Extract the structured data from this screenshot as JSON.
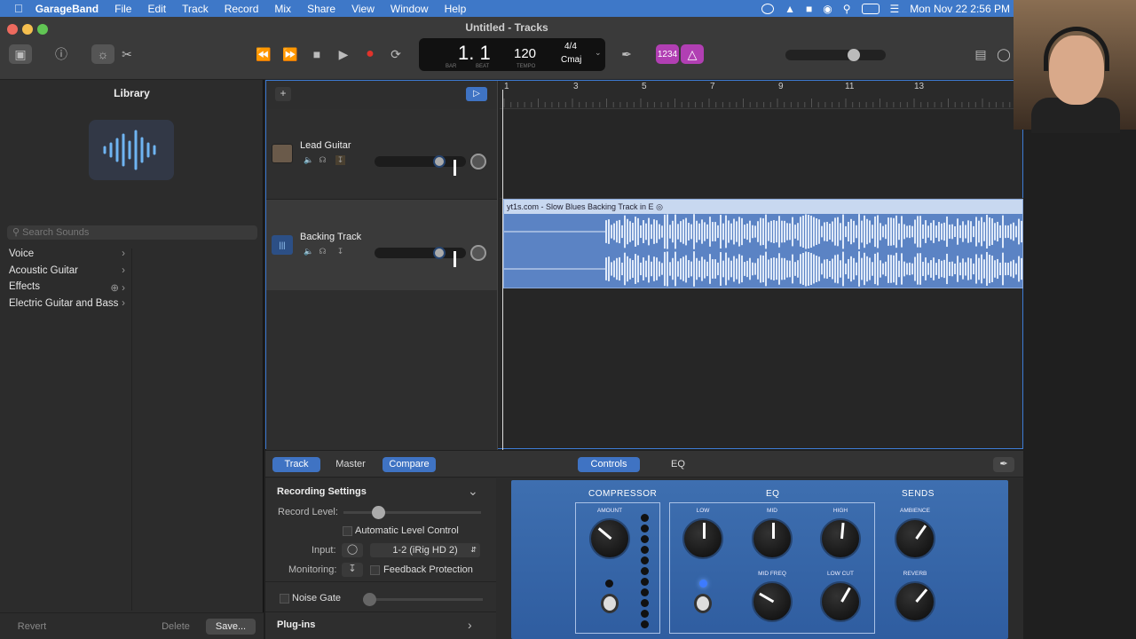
{
  "menubar": {
    "app": "GarageBand",
    "items": [
      "File",
      "Edit",
      "Track",
      "Record",
      "Mix",
      "Share",
      "View",
      "Window",
      "Help"
    ],
    "clock": "Mon Nov 22  2:56 PM"
  },
  "window": {
    "title": "Untitled - Tracks"
  },
  "lcd": {
    "bar_beat": "1. 1",
    "bar_label": "BAR",
    "beat_label": "BEAT",
    "tempo": "120",
    "tempo_label": "TEMPO",
    "signature": "4/4",
    "key": "Cmaj"
  },
  "toolbar": {
    "count_in": "1234"
  },
  "library": {
    "title": "Library",
    "search_placeholder": "Search Sounds",
    "items": [
      "Voice",
      "Acoustic Guitar",
      "Effects",
      "Electric Guitar and Bass"
    ],
    "revert": "Revert",
    "delete": "Delete",
    "save": "Save..."
  },
  "tracks": [
    {
      "name": "Lead Guitar",
      "volume": 0.72
    },
    {
      "name": "Backing Track",
      "volume": 0.72
    }
  ],
  "ruler": [
    "1",
    "3",
    "5",
    "7",
    "9",
    "11",
    "13"
  ],
  "region": {
    "name": "yt1s.com - Slow Blues Backing Track in E"
  },
  "smart": {
    "tabs_left": [
      "Track",
      "Master",
      "Compare"
    ],
    "tabs_right": [
      "Controls",
      "EQ"
    ],
    "recording_settings": "Recording Settings",
    "record_level": "Record Level:",
    "alc": "Automatic Level Control",
    "input_label": "Input:",
    "input_value": "1-2  (iRig HD 2)",
    "monitoring": "Monitoring:",
    "feedback": "Feedback Protection",
    "noise_gate": "Noise Gate",
    "plugins": "Plug-ins"
  },
  "amp": {
    "compressor": "COMPRESSOR",
    "eq": "EQ",
    "sends": "SENDS",
    "amount": "AMOUNT",
    "low": "LOW",
    "mid": "MID",
    "high": "HIGH",
    "mid_freq": "MID FREQ",
    "low_cut": "LOW CUT",
    "ambience": "AMBIENCE",
    "reverb": "REVERB"
  }
}
